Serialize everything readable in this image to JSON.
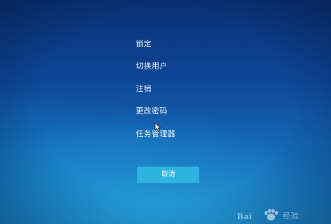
{
  "security_options": {
    "items": [
      {
        "label": "锁定"
      },
      {
        "label": "切换用户"
      },
      {
        "label": "注销"
      },
      {
        "label": "更改密码"
      },
      {
        "label": "任务管理器"
      }
    ],
    "cancel_label": "取消"
  },
  "colors": {
    "background_top": "#0a2f72",
    "background_bottom": "#1b86c9",
    "button": "#2fb3df",
    "text": "#eef6ff"
  },
  "watermark": {
    "text_left": "Bai",
    "text_right": "经验"
  }
}
